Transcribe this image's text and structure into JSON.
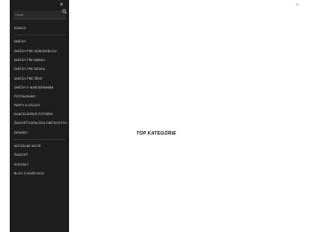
{
  "drawer": {
    "close_label": "×",
    "search": {
      "placeholder": "Hľadať",
      "value": ""
    },
    "home_label": "DOMOV",
    "categories": [
      {
        "label": "DNÍČKY"
      },
      {
        "label": "DNÍČKY PRE SÚRODENCOV"
      },
      {
        "label": "DNÍČKY PRE BABKU"
      },
      {
        "label": "DNÍČKY PRE DEDKA"
      },
      {
        "label": "DNÍČKY PRE ŽENY"
      },
      {
        "label": "DNÍČKY K NARODENINÁM"
      },
      {
        "label": "FOTOALBUMY"
      },
      {
        "label": "PARTY A OSLAVY"
      },
      {
        "label": "KANCELÁRSKE POTREBY"
      },
      {
        "label": "ŽIADOSŤ KATALÓGU DNÍČKOVÝCH"
      },
      {
        "label": "DENNÍKY"
      }
    ],
    "secondary": [
      {
        "label": "AKTUÁLNE AKCIE"
      },
      {
        "label": "ŽIADOSŤ"
      },
      {
        "label": "KONTAKT"
      },
      {
        "label": "BLOG O DNÍČKOCH"
      }
    ]
  },
  "main": {
    "title": "TOP KATEGÓRIE"
  },
  "scrollbar": {
    "close_glyph": "×"
  }
}
